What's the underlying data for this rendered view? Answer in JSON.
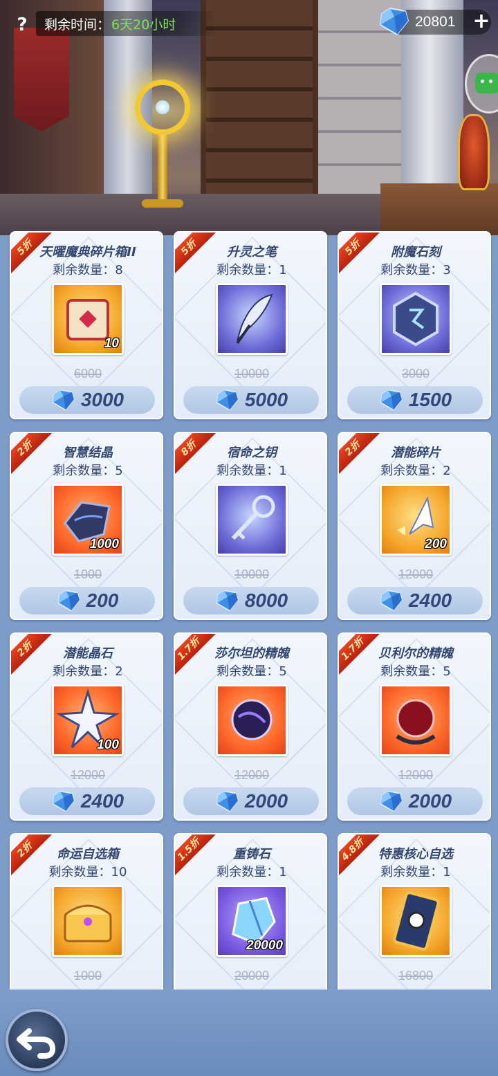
{
  "header": {
    "help_label": "?",
    "time_label": "剩余时间：",
    "time_value": "6天20小时",
    "currency_value": "20801",
    "plus_label": "+"
  },
  "colors": {
    "ribbon": "#d2321a",
    "card_bg": "#eef3fb",
    "price_text": "#33477a",
    "time_value": "#7ce35a"
  },
  "items": [
    {
      "discount": "5折",
      "name": "天曜魔典碎片箱II",
      "stock": "剩余数量：8",
      "icon": "treasure-cube-icon",
      "qty": "10",
      "original": "6000",
      "price": "3000"
    },
    {
      "discount": "5折",
      "name": "升灵之笔",
      "stock": "剩余数量：1",
      "icon": "feather-quill-icon",
      "qty": "",
      "original": "10000",
      "price": "5000"
    },
    {
      "discount": "5折",
      "name": "附魔石刻",
      "stock": "剩余数量：3",
      "icon": "rune-stone-icon",
      "qty": "",
      "original": "3000",
      "price": "1500"
    },
    {
      "discount": "2折",
      "name": "智慧结晶",
      "stock": "剩余数量：5",
      "icon": "dark-crystal-icon",
      "qty": "1000",
      "original": "1000",
      "price": "200"
    },
    {
      "discount": "8折",
      "name": "宿命之钥",
      "stock": "剩余数量：1",
      "icon": "silver-key-icon",
      "qty": "",
      "original": "10000",
      "price": "8000"
    },
    {
      "discount": "2折",
      "name": "潜能碎片",
      "stock": "剩余数量：2",
      "icon": "crystal-shard-icon",
      "qty": "200",
      "original": "12000",
      "price": "2400"
    },
    {
      "discount": "2折",
      "name": "潜能晶石",
      "stock": "剩余数量：2",
      "icon": "star-crystal-icon",
      "qty": "100",
      "original": "12000",
      "price": "2400"
    },
    {
      "discount": "1.7折",
      "name": "莎尔坦的精魄",
      "stock": "剩余数量：5",
      "icon": "purple-orb-icon",
      "qty": "",
      "original": "12000",
      "price": "2000"
    },
    {
      "discount": "1.7折",
      "name": "贝利尔的精魄",
      "stock": "剩余数量：5",
      "icon": "red-orb-icon",
      "qty": "",
      "original": "12000",
      "price": "2000"
    },
    {
      "discount": "2折",
      "name": "命运自选箱",
      "stock": "剩余数量：10",
      "icon": "golden-chest-icon",
      "qty": "",
      "original": "1000",
      "price": ""
    },
    {
      "discount": "1.5折",
      "name": "重铸石",
      "stock": "剩余数量：1",
      "icon": "reforge-stone-icon",
      "qty": "20000",
      "original": "20000",
      "price": ""
    },
    {
      "discount": "4.8折",
      "name": "特惠核心自选",
      "stock": "剩余数量：1",
      "icon": "core-card-icon",
      "qty": "",
      "original": "16800",
      "price": ""
    }
  ]
}
